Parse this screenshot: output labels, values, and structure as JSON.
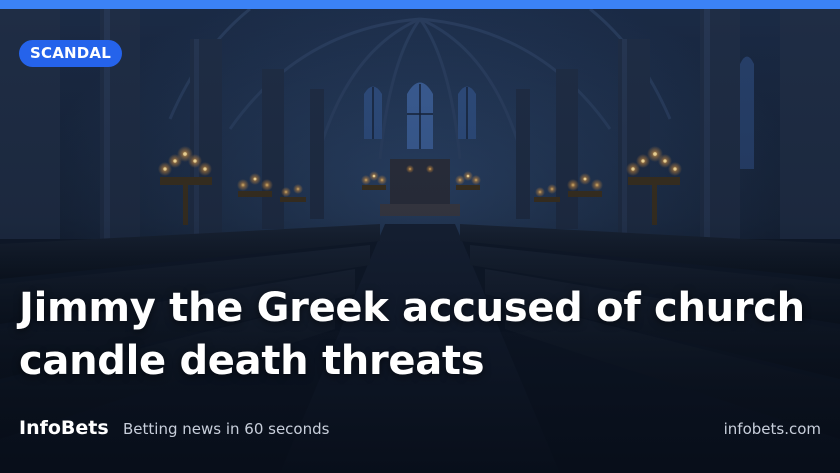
{
  "card": {
    "category_badge": "SCANDAL",
    "headline": "Jimmy the Greek accused of church candle death threats",
    "background_image": "cathedral-interior-candles"
  },
  "footer": {
    "brand": "InfoBets",
    "tagline": "Betting news in 60 seconds",
    "domain": "infobets.com"
  },
  "colors": {
    "accent": "#3b82f6",
    "badge": "#2563eb",
    "text": "#ffffff",
    "muted_text": "#c8cfdb",
    "background": "#0b1424"
  }
}
